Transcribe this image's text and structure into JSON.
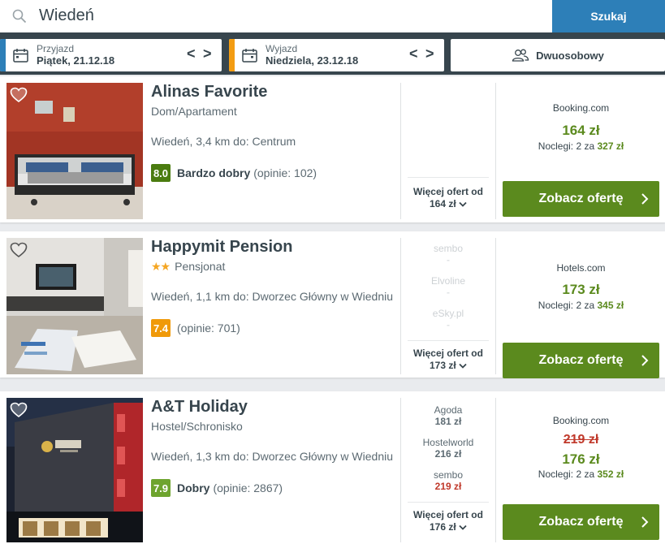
{
  "search": {
    "value": "Wiedeń",
    "button_label": "Szukaj"
  },
  "checkin": {
    "label": "Przyjazd",
    "value": "Piątek, 21.12.18",
    "prev": "<",
    "next": ">"
  },
  "checkout": {
    "label": "Wyjazd",
    "value": "Niedziela, 23.12.18",
    "prev": "<",
    "next": ">"
  },
  "room": {
    "label": "Dwuosobowy"
  },
  "colors": {
    "accent_checkin": "#2d7fb8",
    "accent_checkout": "#f39c12",
    "cta_green": "#5b8a1e",
    "header_dark": "#37454d"
  },
  "hotels": [
    {
      "name": "Alinas Favorite",
      "type": "Dom/Apartament",
      "stars": "",
      "location": "Wiedeń, 3,4 km do: Centrum",
      "rating": {
        "score": "8.0",
        "label": "Bardzo dobry",
        "reviews": "(opinie: 102)",
        "color": "#4b7c10"
      },
      "offers": [],
      "more_label": "Więcej ofert od",
      "more_price": "164 zł",
      "best": {
        "provider": "Booking.com",
        "old_price": "",
        "price": "164 zł",
        "nights_prefix": "Noclegi: 2 za",
        "nights_total": "327 zł"
      },
      "cta_label": "Zobacz ofertę"
    },
    {
      "name": "Happymit Pension",
      "type": "Pensjonat",
      "stars": "★★",
      "location": "Wiedeń, 1,1 km do: Dworzec Główny w Wiedniu",
      "rating": {
        "score": "7.4",
        "label": "",
        "reviews": "(opinie: 701)",
        "color": "#f09a0a"
      },
      "offers": [
        {
          "provider": "sembo",
          "price": "-"
        },
        {
          "provider": "Elvoline",
          "price": "-"
        },
        {
          "provider": "eSky.pl",
          "price": "-"
        }
      ],
      "more_label": "Więcej ofert od",
      "more_price": "173 zł",
      "best": {
        "provider": "Hotels.com",
        "old_price": "",
        "price": "173 zł",
        "nights_prefix": "Noclegi: 2 za",
        "nights_total": "345 zł"
      },
      "cta_label": "Zobacz ofertę"
    },
    {
      "name": "A&T Holiday",
      "type": "Hostel/Schronisko",
      "stars": "",
      "location": "Wiedeń, 1,3 km do: Dworzec Główny w Wiedniu",
      "rating": {
        "score": "7.9",
        "label": "Dobry",
        "reviews": "(opinie: 2867)",
        "color": "#6ea42e"
      },
      "offers": [
        {
          "provider": "Agoda",
          "price": "181 zł"
        },
        {
          "provider": "Hostelworld",
          "price": "216 zł"
        },
        {
          "provider": "sembo",
          "price": "219 zł"
        }
      ],
      "more_label": "Więcej ofert od",
      "more_price": "176 zł",
      "best": {
        "provider": "Booking.com",
        "old_price": "219 zł",
        "price": "176 zł",
        "nights_prefix": "Noclegi: 2 za",
        "nights_total": "352 zł"
      },
      "cta_label": "Zobacz ofertę"
    }
  ]
}
